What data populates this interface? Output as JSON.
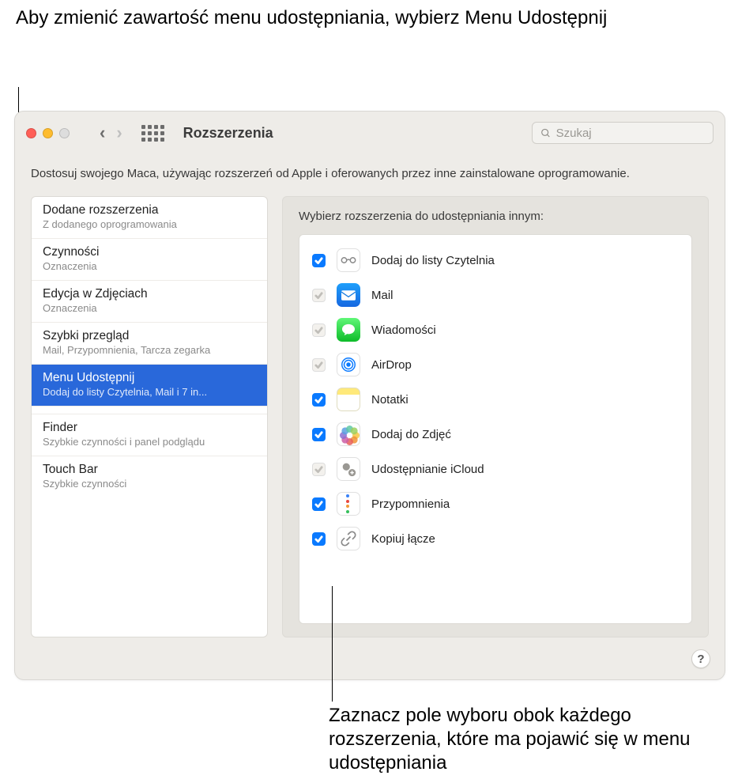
{
  "callouts": {
    "top": "Aby zmienić zawartość menu udostępniania, wybierz Menu Udostępnij",
    "bottom": "Zaznacz pole wyboru obok każdego rozszerzenia, które ma pojawić się w menu udostępniania"
  },
  "window": {
    "title": "Rozszerzenia",
    "search_placeholder": "Szukaj",
    "description": "Dostosuj swojego Maca, używając rozszerzeń od Apple i oferowanych przez inne zainstalowane oprogramowanie.",
    "help_label": "?"
  },
  "sidebar": [
    {
      "title": "Dodane rozszerzenia",
      "subtitle": "Z dodanego oprogramowania",
      "selected": false
    },
    {
      "title": "Czynności",
      "subtitle": "Oznaczenia",
      "selected": false
    },
    {
      "title": "Edycja w Zdjęciach",
      "subtitle": "Oznaczenia",
      "selected": false
    },
    {
      "title": "Szybki przegląd",
      "subtitle": "Mail, Przypomnienia, Tarcza zegarka",
      "selected": false
    },
    {
      "title": "Menu Udostępnij",
      "subtitle": "Dodaj do listy Czytelnia, Mail i 7 in...",
      "selected": true
    },
    {
      "title": "Finder",
      "subtitle": "Szybkie czynności i panel podglądu",
      "selected": false
    },
    {
      "title": "Touch Bar",
      "subtitle": "Szybkie czynności",
      "selected": false
    }
  ],
  "main": {
    "heading": "Wybierz rozszerzenia do udostępniania innym:",
    "items": [
      {
        "label": "Dodaj do listy Czytelnia",
        "checked": true,
        "disabled": false,
        "icon": "reading-list-icon"
      },
      {
        "label": "Mail",
        "checked": true,
        "disabled": true,
        "icon": "mail-icon"
      },
      {
        "label": "Wiadomości",
        "checked": true,
        "disabled": true,
        "icon": "messages-icon"
      },
      {
        "label": "AirDrop",
        "checked": true,
        "disabled": true,
        "icon": "airdrop-icon"
      },
      {
        "label": "Notatki",
        "checked": true,
        "disabled": false,
        "icon": "notes-icon"
      },
      {
        "label": "Dodaj do Zdjęć",
        "checked": true,
        "disabled": false,
        "icon": "photos-icon"
      },
      {
        "label": "Udostępnianie iCloud",
        "checked": true,
        "disabled": true,
        "icon": "icloud-sharing-icon"
      },
      {
        "label": "Przypomnienia",
        "checked": true,
        "disabled": false,
        "icon": "reminders-icon"
      },
      {
        "label": "Kopiuj łącze",
        "checked": true,
        "disabled": false,
        "icon": "copy-link-icon"
      }
    ]
  }
}
